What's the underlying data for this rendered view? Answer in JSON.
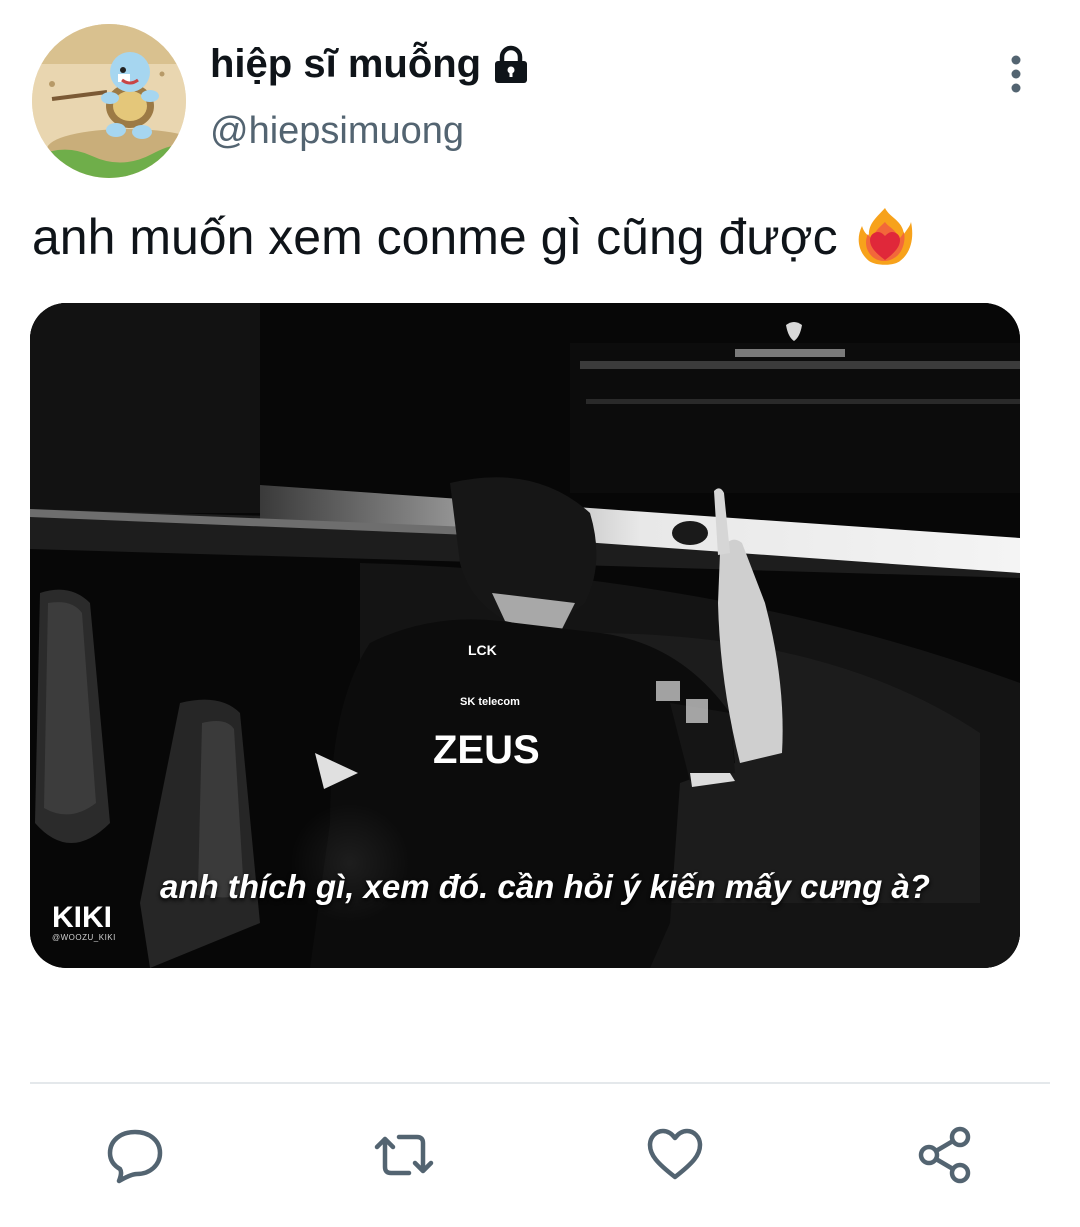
{
  "user": {
    "display_name": "hiệp sĩ muỗng",
    "handle": "@hiepsimuong",
    "protected_icon": "lock-icon",
    "avatar": "squirtle-avatar"
  },
  "tweet": {
    "text": "anh muốn xem conme gì cũng được",
    "emoji": "heart-on-fire-emoji"
  },
  "media": {
    "jersey_brand": "SK telecom",
    "jersey_league": "LCK",
    "jersey_name": "ZEUS",
    "caption": "anh thích gì, xem đó. cần hỏi ý kiến mấy cưng à?",
    "watermark": "KIKI",
    "watermark_handle": "@WOOZU_KIKI"
  },
  "actions": {
    "reply_icon": "reply-icon",
    "retweet_icon": "retweet-icon",
    "like_icon": "heart-icon",
    "share_icon": "share-icon"
  },
  "colors": {
    "text": "#0f1419",
    "secondary": "#536471",
    "icon": "#536471",
    "divider": "#e4e8eb"
  }
}
